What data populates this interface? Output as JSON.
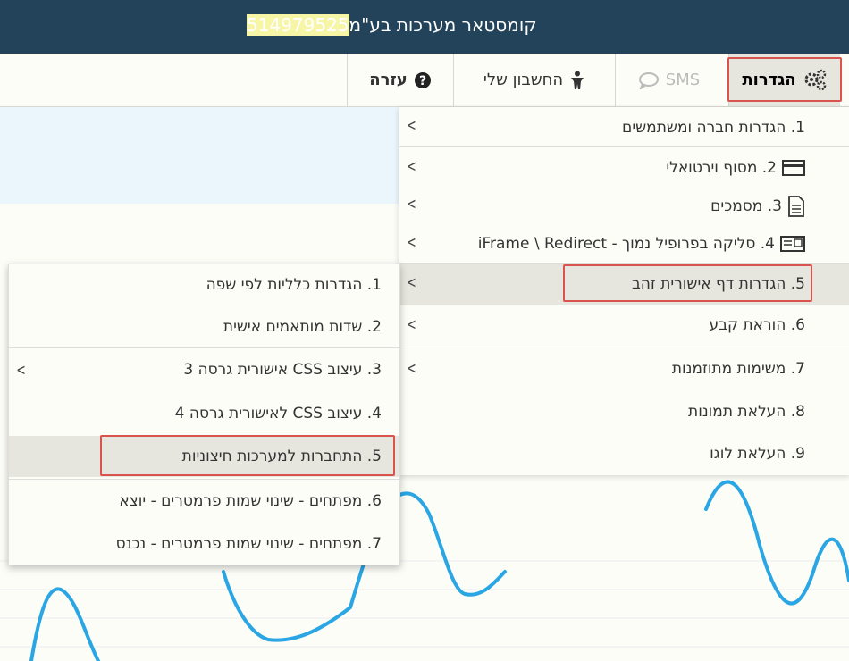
{
  "title": {
    "text": "קומסטאר מערכות בע\"מ",
    "id_number": "514979525"
  },
  "menubar": {
    "settings": "הגדרות",
    "sms": "SMS",
    "account": "החשבון שלי",
    "help": "עזרה"
  },
  "menu1": {
    "items": [
      {
        "label": "1. הגדרות חברה ומשתמשים"
      },
      {
        "label": "2. מסוף וירטואלי"
      },
      {
        "label": "3. מסמכים"
      },
      {
        "label": "4. סליקה בפרופיל נמוך - iFrame \\ Redirect"
      },
      {
        "label": "5. הגדרות דף אישורית זהב"
      },
      {
        "label": "6. הוראת קבע"
      },
      {
        "label": "7. משימות מתוזמנות"
      },
      {
        "label": "8. העלאת תמונות"
      },
      {
        "label": "9. העלאת לוגו"
      }
    ]
  },
  "menu2": {
    "items": [
      {
        "label": "1. הגדרות כלליות לפי שפה"
      },
      {
        "label": "2. שדות מותאמים אישית"
      },
      {
        "label": "3. עיצוב CSS אישורית גרסה 3"
      },
      {
        "label": "4. עיצוב CSS לאישורית גרסה 4"
      },
      {
        "label": "5. התחברות למערכות חיצוניות"
      },
      {
        "label": "6. מפתחים - שינוי שמות פרמטרים - יוצא"
      },
      {
        "label": "7. מפתחים - שינוי שמות פרמטרים - נכנס"
      }
    ]
  },
  "colors": {
    "titlebar": "#22435a",
    "highlight": "#f7f5a6",
    "chart_line": "#29a6e3",
    "red_box": "#d9534f"
  }
}
